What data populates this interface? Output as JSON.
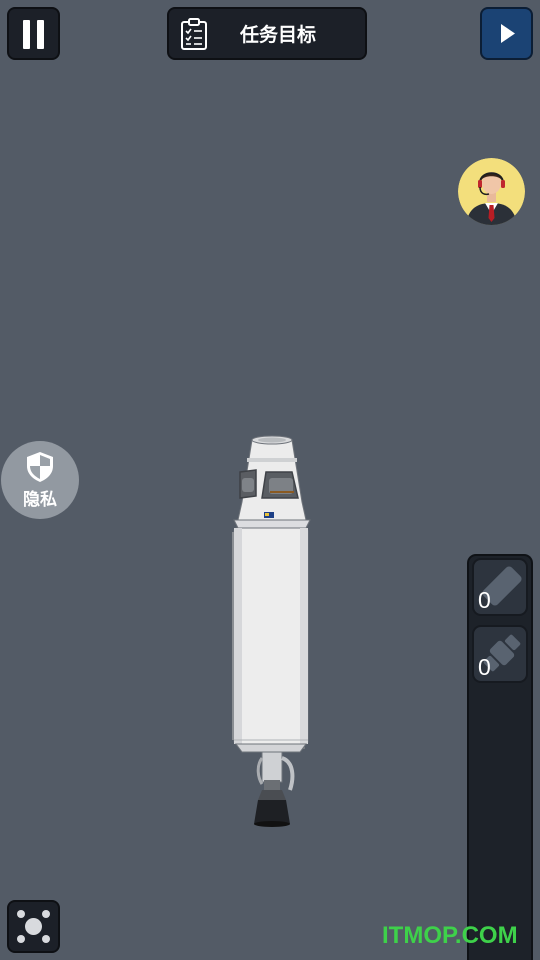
{
  "toolbar": {
    "pause_icon": "pause-icon",
    "mission_label": "任务目标",
    "mission_icon": "clipboard-checklist-icon",
    "play_icon": "play-icon"
  },
  "advisor": {
    "icon": "headset-advisor-avatar-icon",
    "bg_color": "#f3df7c"
  },
  "privacy": {
    "label": "隐私",
    "icon": "shield-icon"
  },
  "stages_panel": {
    "slots": [
      {
        "icon": "fuel-tank-icon",
        "count": "0"
      },
      {
        "icon": "separator-icon",
        "count": "0"
      }
    ]
  },
  "parts_button": {
    "icon": "parts-grid-icon"
  },
  "watermark": "ITMOP.COM",
  "colors": {
    "background": "#535b66",
    "button_dark": "#1c2028",
    "play_blue": "#1b4374",
    "watermark": "#3ed14a"
  }
}
